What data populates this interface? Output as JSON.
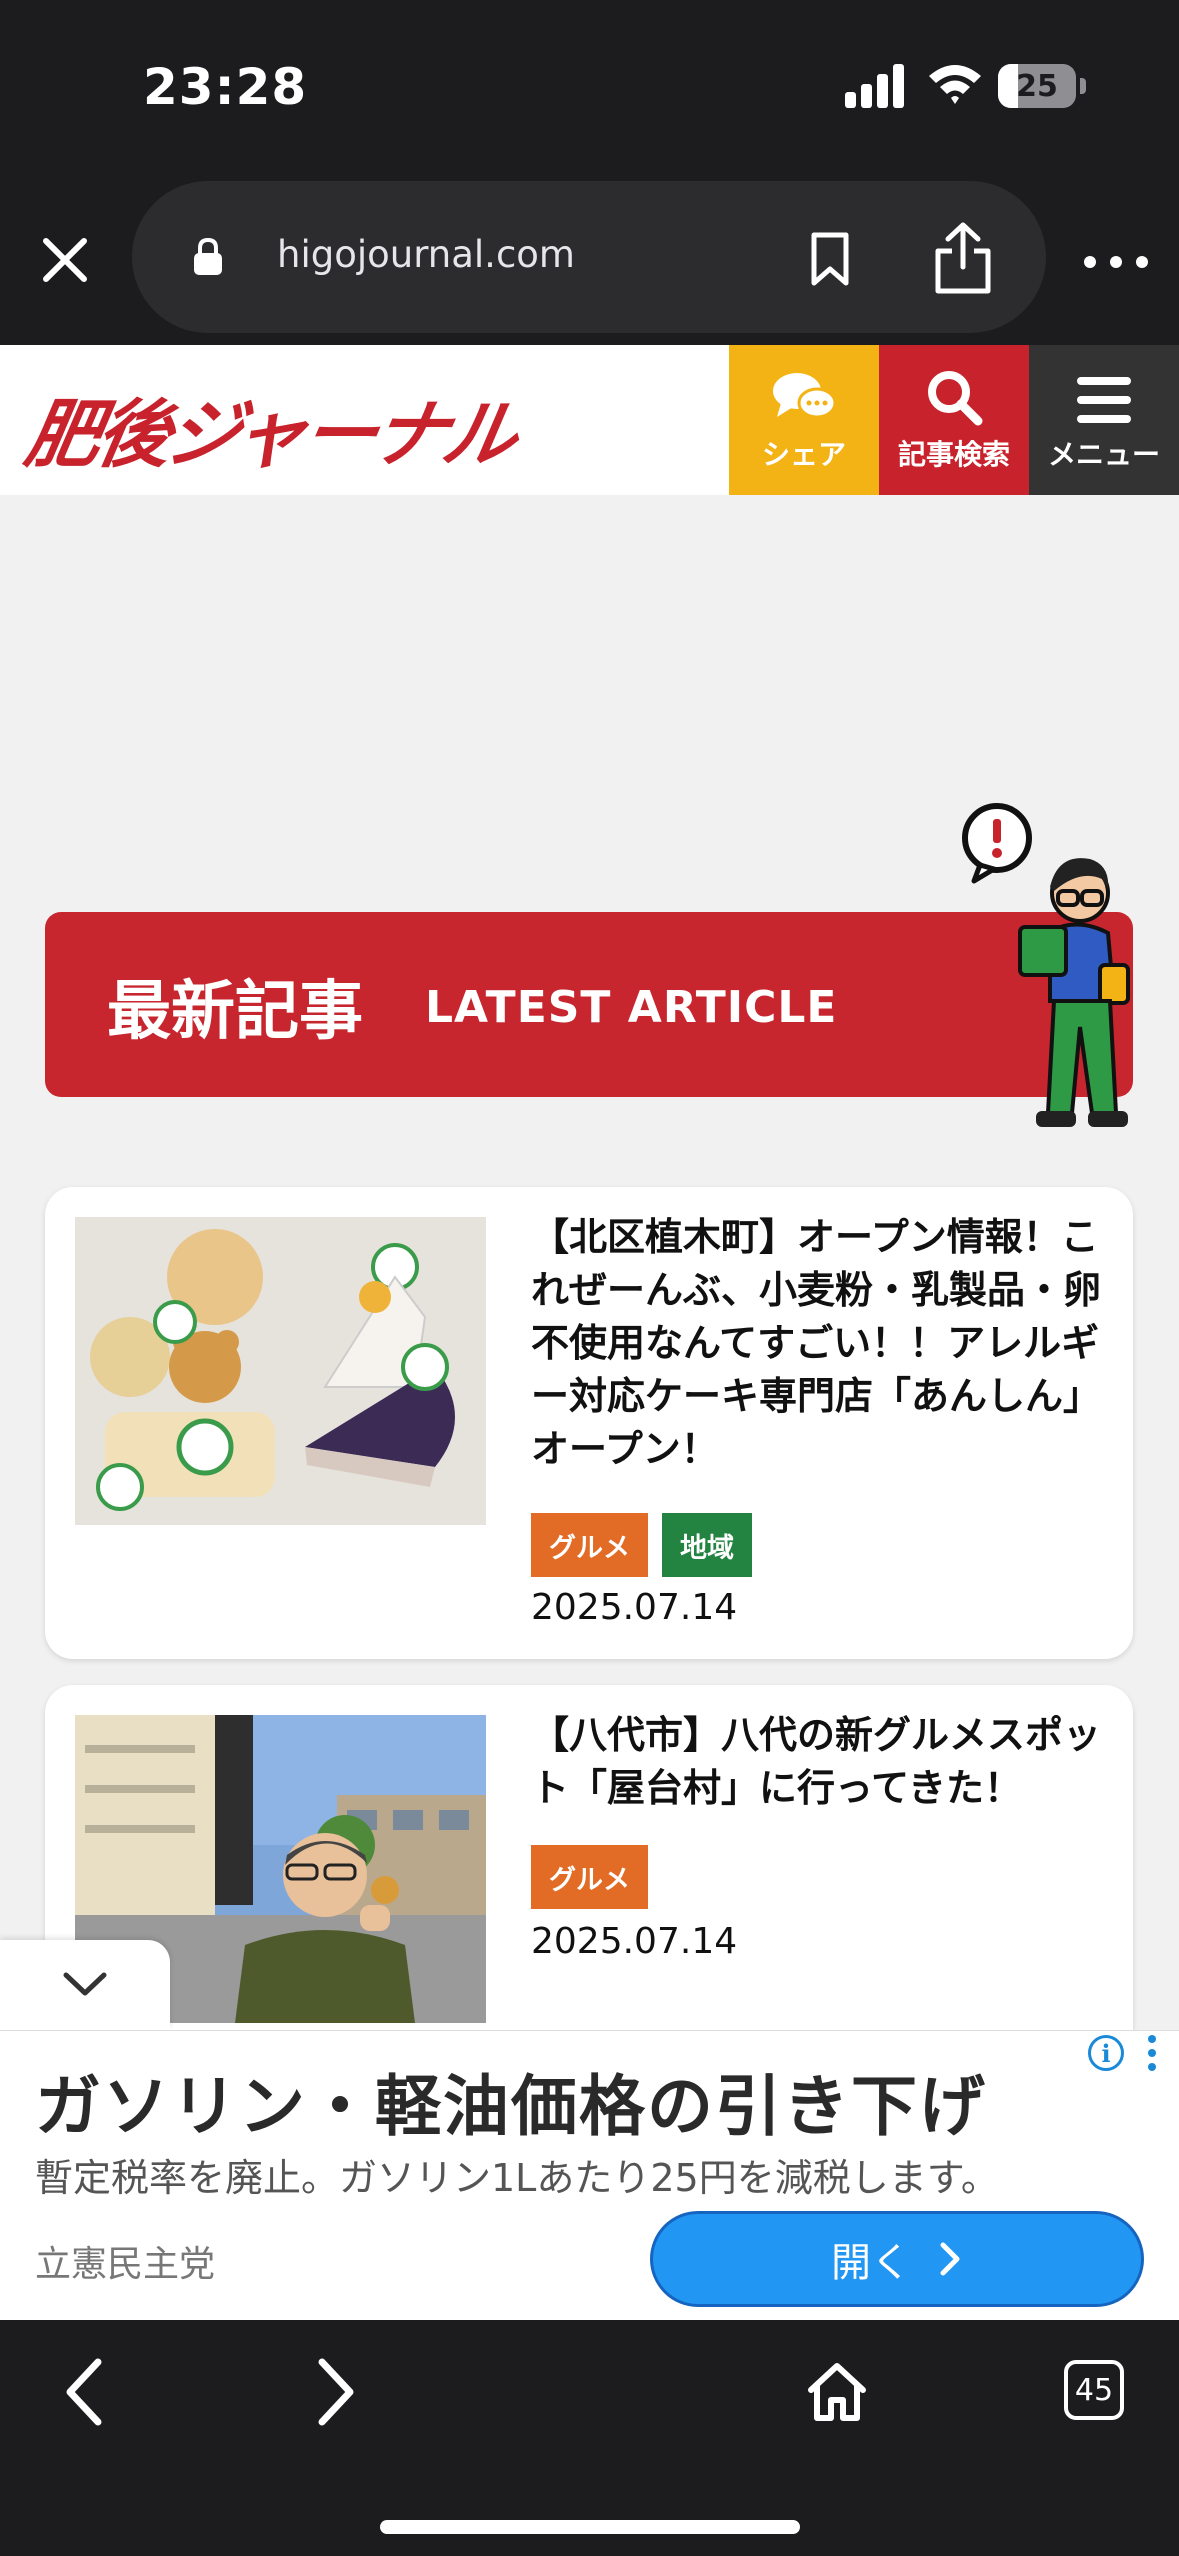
{
  "status_bar": {
    "time": "23:28",
    "battery_level": "25",
    "battery_fraction": 0.25
  },
  "browser": {
    "url": "higojournal.com",
    "icons": [
      "close-icon",
      "lock-icon",
      "bookmark-icon",
      "share-icon",
      "more-icon"
    ]
  },
  "site_header": {
    "logo_text": "肥後ジャーナル",
    "share_label": "シェア",
    "search_label": "記事検索",
    "menu_label": "メニュー",
    "colors": {
      "share": "#f4b315",
      "search": "#c8232c",
      "menu": "#333333"
    }
  },
  "section": {
    "title_jp": "最新記事",
    "title_en": "LATEST ARTICLE",
    "color": "#c7262e"
  },
  "articles": [
    {
      "title": "【北区植木町】オープン情報！これぜーんぶ、小麦粉・乳製品・卵不使用なんてすごい！！アレルギー対応ケーキ専門店「あんしん」オープン！",
      "tags": [
        "グルメ",
        "地域"
      ],
      "date": "2025.07.14"
    },
    {
      "title": "【八代市】八代の新グルメスポット「屋台村」に行ってきた！",
      "tags": [
        "グルメ"
      ],
      "date": "2025.07.14"
    }
  ],
  "ad": {
    "title": "ガソリン・軽油価格の引き下げ",
    "description": "暫定税率を廃止。ガソリン1Lあたり25円を減税します。",
    "advertiser": "立憲民主党",
    "open_label": "開く",
    "info_glyph": "i"
  },
  "toolbar": {
    "tab_count": "45"
  }
}
